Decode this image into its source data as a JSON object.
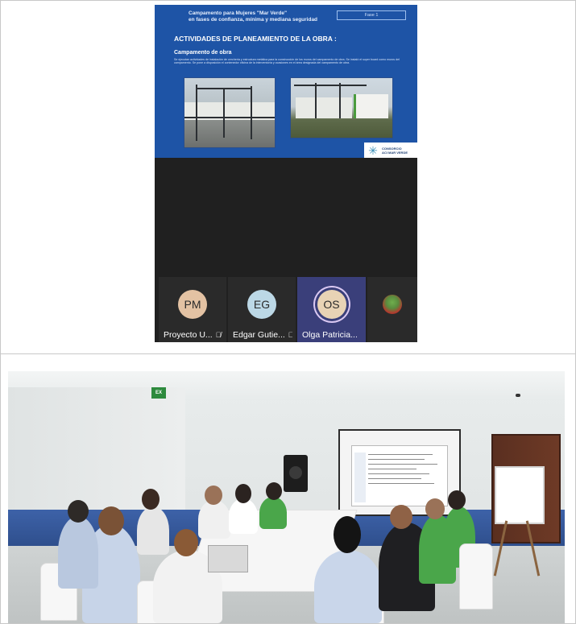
{
  "meeting": {
    "slide": {
      "header_line1": "Campamento para Mujeres \"Mar Verde\"",
      "header_line2": "en fases de confianza, mínima y mediana seguridad",
      "phase": "Fase 1",
      "title": "ACTIVIDADES DE PLANEAMIENTO DE LA OBRA :",
      "subtitle": "Campamento de obra",
      "body": "Se ejecutan actividades de instalación de cerchería y estructura metálica para la construcción de los muros del campamento de obra. Se instaló el super board como muros del campamento. Se pone a disposición el contenedor oficina de la interventoría y ocasiones en el área designada del campamento de obra.",
      "logo_line1": "CONSORCIO",
      "logo_line2": "ACI MAR VERDE",
      "colors": {
        "background": "#1e54a6",
        "logo_accent": "#3a8fb7"
      }
    },
    "participants": [
      {
        "initials": "PM",
        "label": "Proyecto U...",
        "muted": true,
        "avatar_color": "#e3c2a3"
      },
      {
        "initials": "EG",
        "label": "Edgar Gutie...",
        "muted": true,
        "avatar_color": "#bcd8e6"
      },
      {
        "initials": "OS",
        "label": "Olga Patricia...",
        "muted": false,
        "speaking": true,
        "avatar_color": "#e8d3b5"
      },
      {
        "initials": "",
        "label": "",
        "muted": false,
        "avatar_type": "photo"
      }
    ],
    "icons": {
      "mute": "mic-off-icon"
    }
  },
  "room_photo": {
    "exit_sign": "EX"
  }
}
